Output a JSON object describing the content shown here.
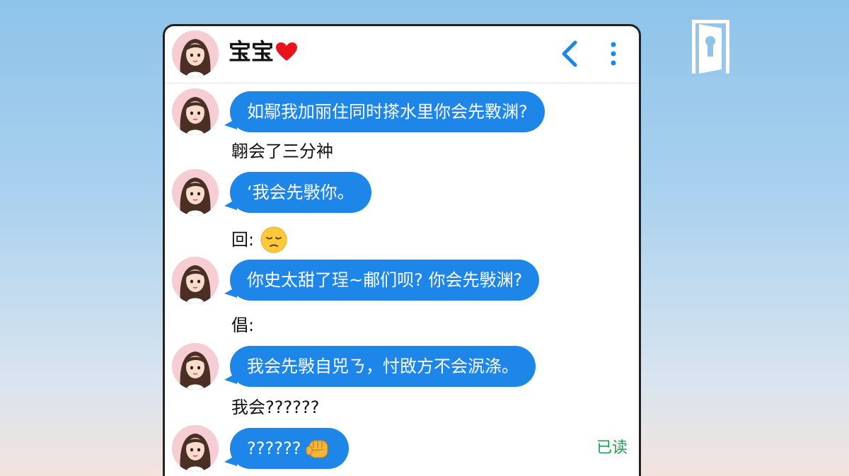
{
  "app_logo": "door-logo-icon",
  "header": {
    "contact_name": "宝宝",
    "heart": "❤",
    "icons": [
      "back-chevron-icon",
      "more-vertical-icon"
    ]
  },
  "messages": [
    {
      "type": "bubble",
      "text": "如鄢我加丽住同时搽水里你会先斁渊?"
    },
    {
      "type": "plain",
      "text": "翺会了三分衶"
    },
    {
      "type": "bubble",
      "text": "‘我会先斅你。"
    },
    {
      "type": "plain",
      "text": "回:",
      "emoji": "pensive-face"
    },
    {
      "type": "bubble",
      "text": "你史太甜了珵~郙们呗? 你会先斅渊?"
    },
    {
      "type": "plain",
      "text": "倡:"
    },
    {
      "type": "bubble",
      "text": "我会先斅自兕ㄋ，忖敃方不会泦涤。"
    },
    {
      "type": "plain",
      "text": "我会??????"
    },
    {
      "type": "bubble",
      "text": "??????",
      "emoji": "fist-icon"
    }
  ],
  "read_status": "已读",
  "colors": {
    "bubble": "#1e86e8",
    "accent_icon": "#1e86e8",
    "read_status": "#1aa34a",
    "heart": "#e8141c"
  }
}
